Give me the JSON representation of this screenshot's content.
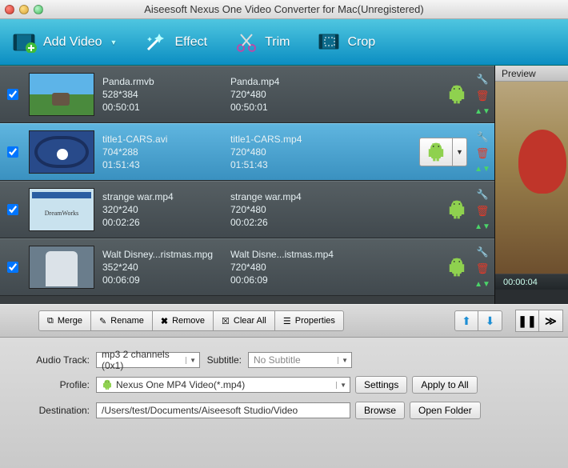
{
  "window": {
    "title": "Aiseesoft Nexus One Video Converter for Mac(Unregistered)"
  },
  "toolbar": {
    "add_video": "Add Video",
    "effect": "Effect",
    "trim": "Trim",
    "crop": "Crop"
  },
  "preview": {
    "label": "Preview",
    "time": "00:00:04"
  },
  "items": [
    {
      "checked": true,
      "src_name": "Panda.rmvb",
      "src_res": "528*384",
      "src_dur": "00:50:01",
      "out_name": "Panda.mp4",
      "out_res": "720*480",
      "out_dur": "00:50:01",
      "selected": false
    },
    {
      "checked": true,
      "src_name": "title1-CARS.avi",
      "src_res": "704*288",
      "src_dur": "01:51:43",
      "out_name": "title1-CARS.mp4",
      "out_res": "720*480",
      "out_dur": "01:51:43",
      "selected": true
    },
    {
      "checked": true,
      "src_name": "strange war.mp4",
      "src_res": "320*240",
      "src_dur": "00:02:26",
      "out_name": "strange war.mp4",
      "out_res": "720*480",
      "out_dur": "00:02:26",
      "selected": false
    },
    {
      "checked": true,
      "src_name": "Walt Disney...ristmas.mpg",
      "src_res": "352*240",
      "src_dur": "00:06:09",
      "out_name": "Walt Disne...istmas.mp4",
      "out_res": "720*480",
      "out_dur": "00:06:09",
      "selected": false
    }
  ],
  "actions": {
    "merge": "Merge",
    "rename": "Rename",
    "remove": "Remove",
    "clear_all": "Clear All",
    "properties": "Properties"
  },
  "form": {
    "audio_track_label": "Audio Track:",
    "audio_track_value": "mp3 2 channels (0x1)",
    "subtitle_label": "Subtitle:",
    "subtitle_value": "No Subtitle",
    "profile_label": "Profile:",
    "profile_value": "Nexus One MP4 Video(*.mp4)",
    "destination_label": "Destination:",
    "destination_value": "/Users/test/Documents/Aiseesoft Studio/Video",
    "settings": "Settings",
    "apply_all": "Apply to All",
    "browse": "Browse",
    "open_folder": "Open Folder"
  }
}
